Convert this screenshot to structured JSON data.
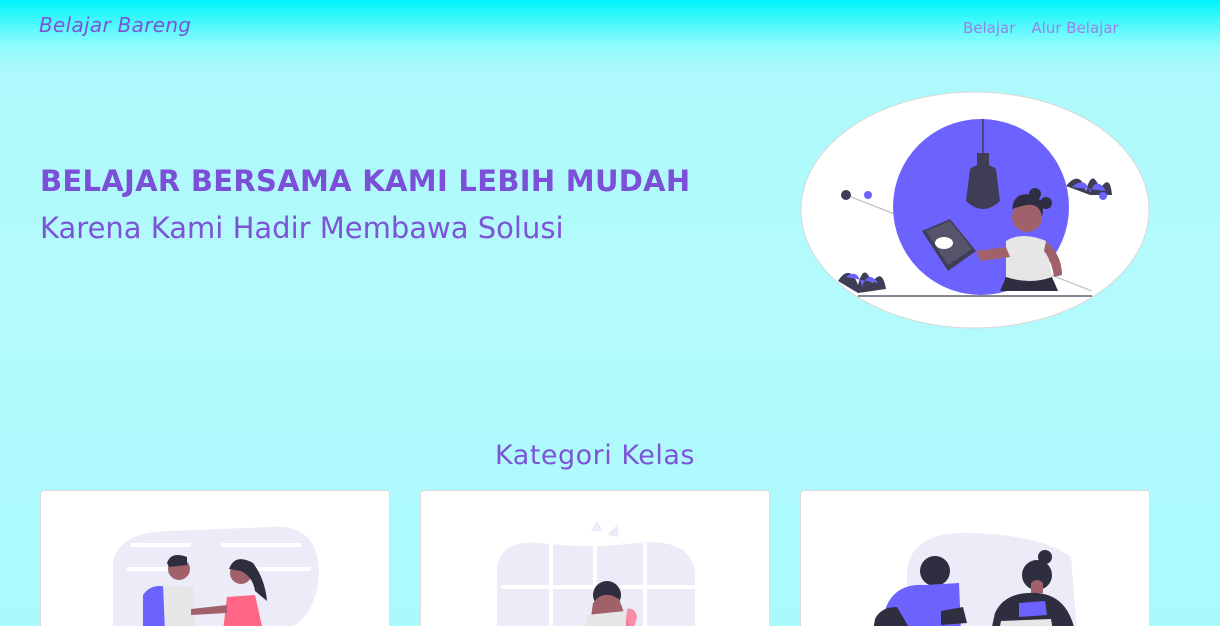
{
  "navbar": {
    "brand": "Belajar Bareng",
    "links": [
      "Belajar",
      "Alur Belajar"
    ]
  },
  "hero": {
    "title": "BELAJAR BERSAMA KAMI LEBIH MUDAH",
    "subtitle": "Karena Kami Hadir Membawa Solusi",
    "illustration": "woman-reading-book-illustration"
  },
  "categories": {
    "heading": "Kategori Kelas",
    "cards": [
      {
        "illustration": "students-meeting-illustration"
      },
      {
        "illustration": "student-studying-window-illustration"
      },
      {
        "illustration": "students-reading-illustration"
      }
    ]
  },
  "colors": {
    "accent": "#7b55d6",
    "illustration_purple": "#6c63ff",
    "bg_top": "#00f5fa",
    "bg_main": "#b3fafc"
  }
}
